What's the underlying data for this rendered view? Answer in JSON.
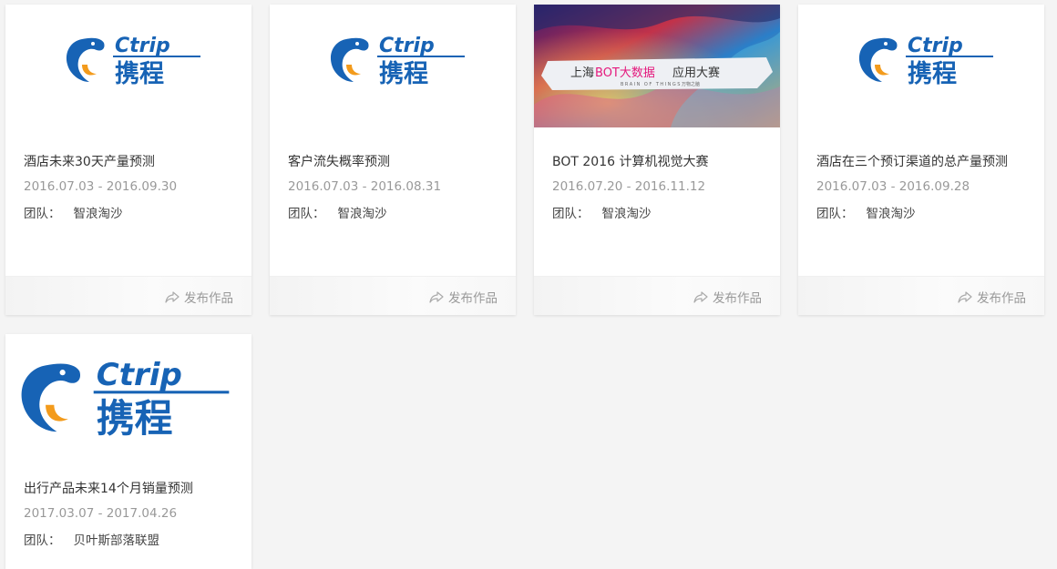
{
  "logo": {
    "brand_latin": "Ctrip",
    "brand_cn": "携程"
  },
  "banner": {
    "headline_prefix": "上海",
    "headline_highlight": "BOT大数据",
    "headline_suffix": "应用大赛",
    "sub": "BRAIN OF THINGS",
    "sub_cn": "万物之脑"
  },
  "cards": [
    {
      "title": "酒店未来30天产量预测",
      "date": "2016.07.03 - 2016.09.30",
      "team_label": "团队：",
      "team": "智浪淘沙",
      "publish": "发布作品"
    },
    {
      "title": "客户流失概率预测",
      "date": "2016.07.03 - 2016.08.31",
      "team_label": "团队：",
      "team": "智浪淘沙",
      "publish": "发布作品"
    },
    {
      "title": "BOT 2016 计算机视觉大赛",
      "date": "2016.07.20 - 2016.11.12",
      "team_label": "团队：",
      "team": "智浪淘沙",
      "publish": "发布作品"
    },
    {
      "title": "酒店在三个预订渠道的总产量预测",
      "date": "2016.07.03 - 2016.09.28",
      "team_label": "团队：",
      "team": "智浪淘沙",
      "publish": "发布作品"
    },
    {
      "title": "出行产品未来14个月销量预测",
      "date": "2017.03.07 - 2017.04.26",
      "team_label": "团队：",
      "team": "贝叶斯部落联盟"
    }
  ],
  "colors": {
    "ctrip_blue": "#1763b5",
    "ctrip_orange": "#f39b1c",
    "highlight_pink": "#e4187c"
  }
}
